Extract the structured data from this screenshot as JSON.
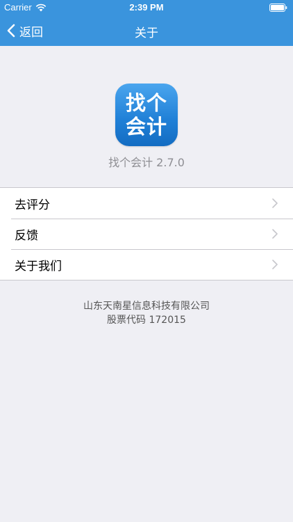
{
  "status_bar": {
    "carrier": "Carrier",
    "time": "2:39 PM",
    "wifi_icon": "wifi-icon",
    "battery_icon": "battery-icon"
  },
  "nav_bar": {
    "back_label": "返回",
    "back_icon": "chevron-left-icon",
    "title": "关于"
  },
  "app": {
    "icon_line1": "找个",
    "icon_line2": "会计",
    "version": "找个会计 2.7.0"
  },
  "menu": {
    "items": [
      {
        "label": "去评分"
      },
      {
        "label": "反馈"
      },
      {
        "label": "关于我们"
      }
    ],
    "chevron_icon": "chevron-right-icon"
  },
  "company": {
    "name": "山东天南星信息科技有限公司",
    "stock_code": "股票代码 172015"
  },
  "colors": {
    "header_blue": "#3a94dd",
    "background": "#efeff4",
    "separator": "#c8c7cc"
  }
}
